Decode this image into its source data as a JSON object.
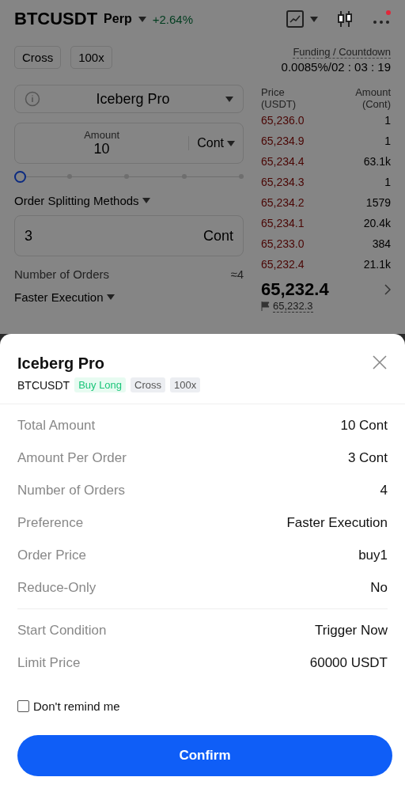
{
  "header": {
    "symbol": "BTCUSDT",
    "contract": "Perp",
    "change": "+2.64%"
  },
  "margin": {
    "buttons": [
      "Cross",
      "100x"
    ],
    "funding_label": "Funding / Countdown",
    "funding_value": "0.0085%/02 : 03 : 19"
  },
  "order_form": {
    "order_type": "Iceberg Pro",
    "amount": {
      "label": "Amount",
      "value": "10",
      "unit": "Cont"
    },
    "slider": {
      "level": 0
    },
    "splitting_label": "Order Splitting Methods",
    "split_field": {
      "value": "3",
      "unit": "Cont"
    },
    "orders_label": "Number of Orders",
    "orders_value": "≈4",
    "preference": "Faster Execution"
  },
  "order_book": {
    "price_header": [
      "Price",
      "(USDT)"
    ],
    "amount_header": [
      "Amount",
      "(Cont)"
    ],
    "asks": [
      {
        "price": "65,236.0",
        "amount": "1"
      },
      {
        "price": "65,234.9",
        "amount": "1"
      },
      {
        "price": "65,234.4",
        "amount": "63.1k"
      },
      {
        "price": "65,234.3",
        "amount": "1"
      },
      {
        "price": "65,234.2",
        "amount": "1579"
      },
      {
        "price": "65,234.1",
        "amount": "20.4k"
      },
      {
        "price": "65,233.0",
        "amount": "384"
      },
      {
        "price": "65,232.4",
        "amount": "21.1k"
      }
    ],
    "last_price": "65,232.4",
    "mark_price": "65,232.3"
  },
  "dialog": {
    "title": "Iceberg Pro",
    "symbol": "BTCUSDT",
    "tags": [
      {
        "label": "Buy Long",
        "kind": "side"
      },
      {
        "label": "Cross",
        "kind": "plain"
      },
      {
        "label": "100x",
        "kind": "plain"
      }
    ],
    "groups": [
      [
        {
          "label": "Total Amount",
          "value": "10 Cont"
        },
        {
          "label": "Amount Per Order",
          "value": "3 Cont"
        },
        {
          "label": "Number of Orders",
          "value": "4"
        },
        {
          "label": "Preference",
          "value": "Faster Execution"
        },
        {
          "label": "Order Price",
          "value": "buy1"
        },
        {
          "label": "Reduce-Only",
          "value": "No"
        }
      ],
      [
        {
          "label": "Start Condition",
          "value": "Trigger Now"
        },
        {
          "label": "Limit Price",
          "value": "60000 USDT"
        }
      ]
    ],
    "remind": {
      "label": "Don't remind me",
      "checked": false
    },
    "confirm": "Confirm"
  }
}
